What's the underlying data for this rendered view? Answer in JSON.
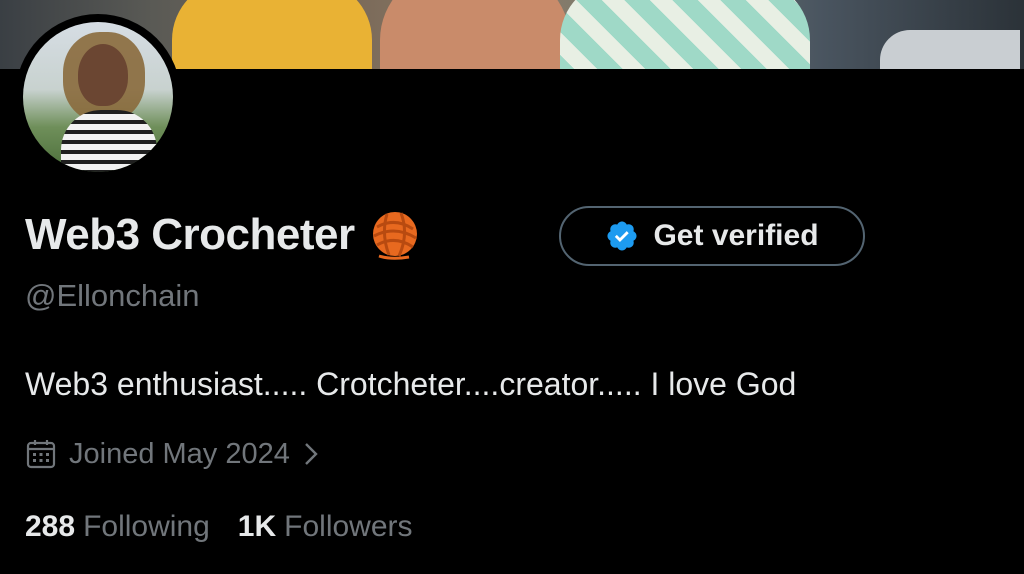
{
  "profile": {
    "display_name": "Web3 Crocheter",
    "handle": "@Ellonchain",
    "bio": "Web3 enthusiast..... Crotcheter....creator..... I love God",
    "joined": "Joined May 2024"
  },
  "actions": {
    "get_verified_label": "Get verified"
  },
  "stats": {
    "following_count": "288",
    "following_label": "Following",
    "followers_count": "1K",
    "followers_label": "Followers"
  },
  "icons": {
    "name_emoji": "yarn-icon",
    "verified_badge": "verified-badge-icon",
    "calendar": "calendar-icon",
    "chevron": "chevron-right-icon"
  },
  "colors": {
    "background": "#000000",
    "primary_text": "#e7e9ea",
    "secondary_text": "#71767b",
    "verified_blue": "#1d9bf0",
    "button_border": "#536471"
  }
}
